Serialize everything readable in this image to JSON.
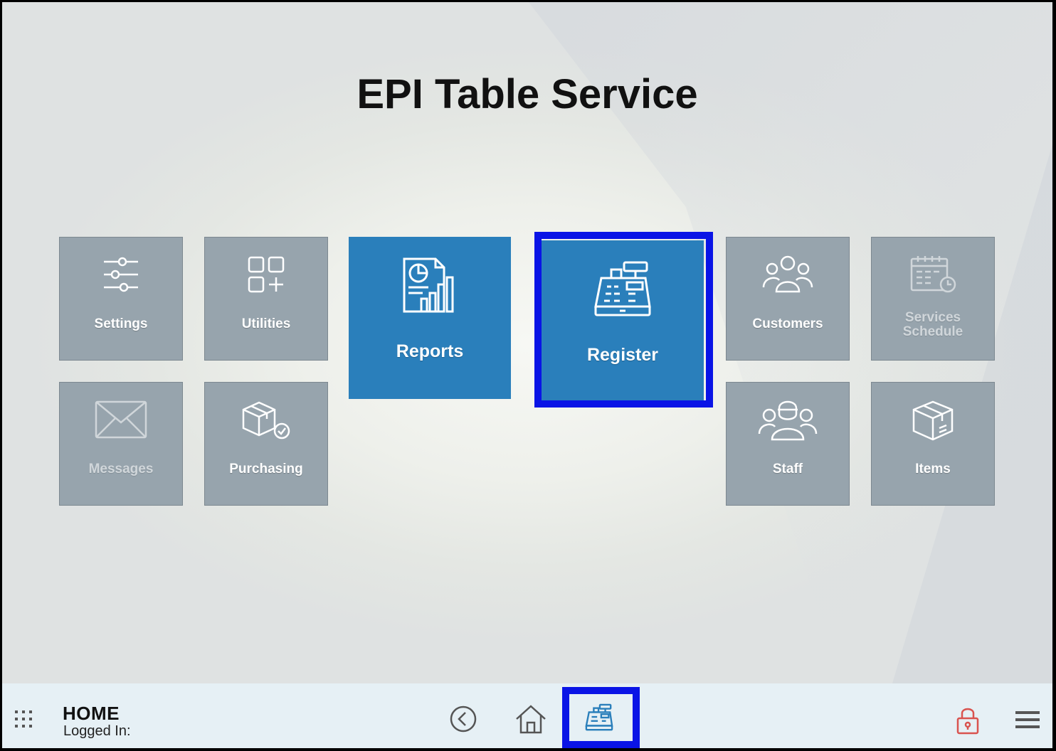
{
  "title": "EPI Table Service",
  "tiles": {
    "settings": "Settings",
    "utilities": "Utilities",
    "reports": "Reports",
    "register": "Register",
    "customers": "Customers",
    "services_schedule": "Services Schedule",
    "messages": "Messages",
    "purchasing": "Purchasing",
    "staff": "Staff",
    "items": "Items"
  },
  "bottombar": {
    "home_label": "HOME",
    "logged_in": "Logged In:"
  },
  "icons": {
    "apps": "apps-grid-icon",
    "back": "back-circle-icon",
    "home": "home-icon",
    "register": "cash-register-icon",
    "lock": "lock-icon",
    "menu": "hamburger-menu-icon"
  },
  "colors": {
    "tile_gray": "#97a4ad",
    "tile_blue": "#2a7fbb",
    "highlight": "#0a14e6",
    "lock_red": "#d9534f"
  }
}
